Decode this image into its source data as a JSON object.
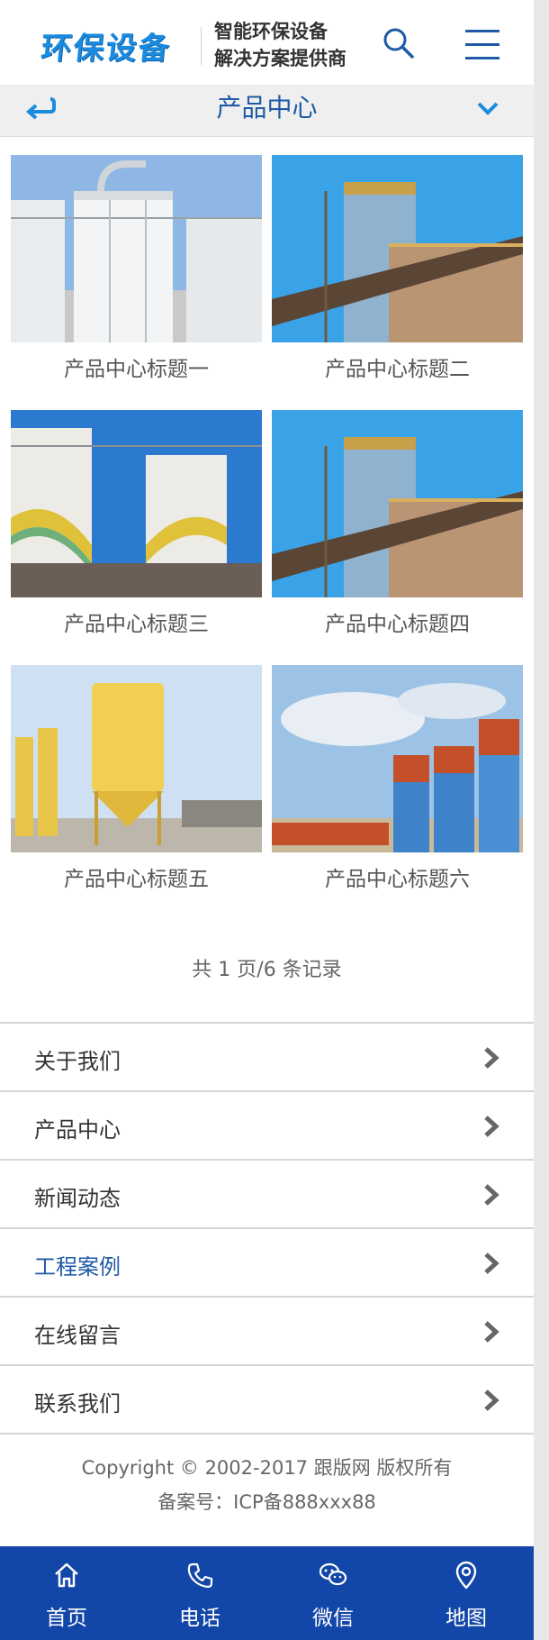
{
  "header": {
    "logo": "环保设备",
    "slogan_line1": "智能环保设备",
    "slogan_line2": "解决方案提供商"
  },
  "titlebar": {
    "title": "产品中心"
  },
  "products": [
    {
      "title": "产品中心标题一"
    },
    {
      "title": "产品中心标题二"
    },
    {
      "title": "产品中心标题三"
    },
    {
      "title": "产品中心标题四"
    },
    {
      "title": "产品中心标题五"
    },
    {
      "title": "产品中心标题六"
    }
  ],
  "pagination": {
    "text": "共 1 页/6 条记录"
  },
  "nav": [
    {
      "label": "关于我们"
    },
    {
      "label": "产品中心"
    },
    {
      "label": "新闻动态"
    },
    {
      "label": "工程案例"
    },
    {
      "label": "在线留言"
    },
    {
      "label": "联系我们"
    }
  ],
  "footer": {
    "copyright": "Copyright © 2002-2017 跟版网 版权所有",
    "icp": "备案号：ICP备888xxx88"
  },
  "bottombar": {
    "tabs": [
      {
        "label": "首页",
        "icon": "home-icon"
      },
      {
        "label": "电话",
        "icon": "phone-icon"
      },
      {
        "label": "微信",
        "icon": "wechat-icon"
      },
      {
        "label": "地图",
        "icon": "map-pin-icon"
      }
    ]
  },
  "colors": {
    "brand": "#1f5aa6",
    "bottombar": "#1246a8",
    "logo": "#1b8be0"
  }
}
